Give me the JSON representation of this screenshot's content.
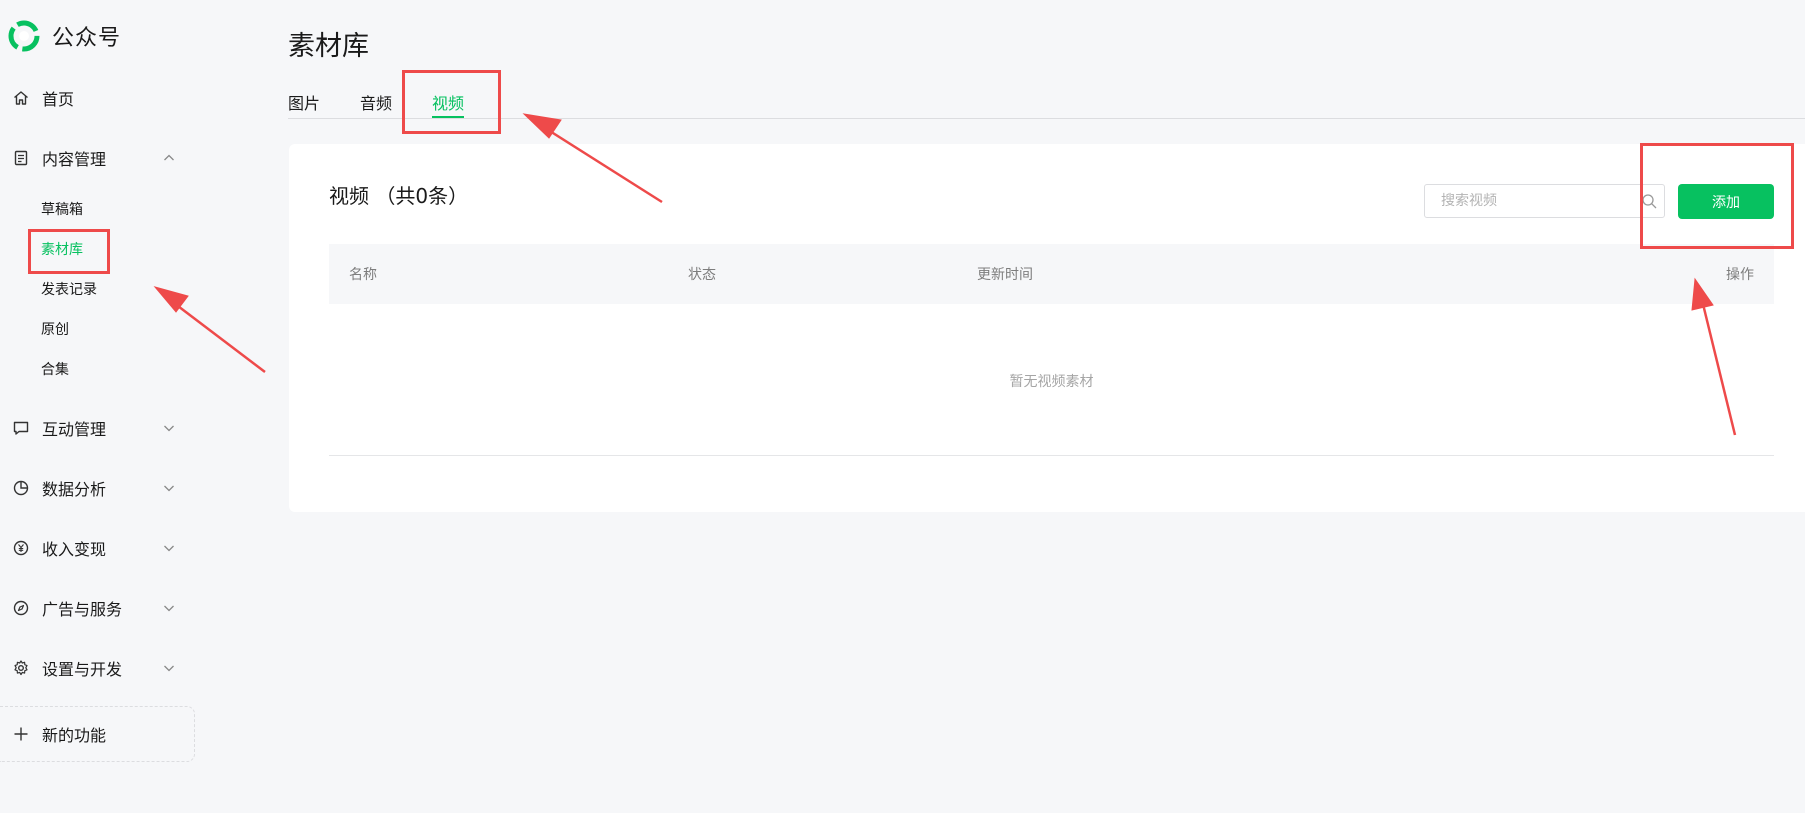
{
  "brand": {
    "name": "公众号",
    "logo_icon": "wechat-official-account-logo"
  },
  "sidebar": {
    "items": [
      {
        "label": "首页",
        "icon": "home-icon"
      },
      {
        "label": "内容管理",
        "icon": "document-icon",
        "expanded": true
      },
      {
        "label": "互动管理",
        "icon": "message-icon"
      },
      {
        "label": "数据分析",
        "icon": "pie-chart-icon"
      },
      {
        "label": "收入变现",
        "icon": "yuan-icon"
      },
      {
        "label": "广告与服务",
        "icon": "compass-icon"
      },
      {
        "label": "设置与开发",
        "icon": "gear-icon"
      }
    ],
    "content_subitems": [
      {
        "label": "草稿箱"
      },
      {
        "label": "素材库",
        "active": true
      },
      {
        "label": "发表记录"
      },
      {
        "label": "原创"
      },
      {
        "label": "合集"
      }
    ],
    "new_feature_label": "新的功能"
  },
  "page": {
    "title": "素材库",
    "tabs": [
      {
        "label": "图片"
      },
      {
        "label": "音频"
      },
      {
        "label": "视频",
        "active": true
      }
    ]
  },
  "card": {
    "title": "视频 （共0条）",
    "search_placeholder": "搜索视频",
    "add_label": "添加",
    "columns": [
      "名称",
      "状态",
      "更新时间",
      "操作"
    ],
    "empty_text": "暂无视频素材"
  },
  "colors": {
    "accent": "#07c160",
    "annotation": "#ee4a4a",
    "background": "#f6f7f9"
  }
}
